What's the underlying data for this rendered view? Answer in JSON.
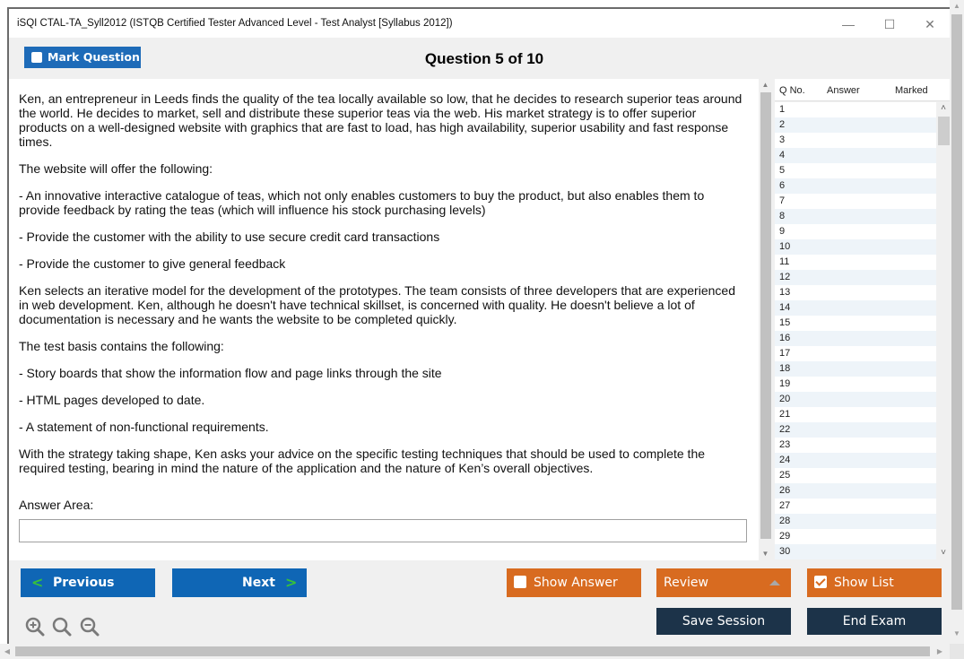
{
  "window": {
    "title": "iSQI CTAL-TA_Syll2012 (ISTQB Certified Tester Advanced Level - Test Analyst [Syllabus 2012])",
    "controls": {
      "minimize": "—",
      "maximize": "☐",
      "close": "✕"
    }
  },
  "header": {
    "mark_question_label": "Mark Question",
    "mark_question_checked": false,
    "question_counter": "Question 5 of 10"
  },
  "question": {
    "paragraphs": [
      "Ken, an entrepreneur in Leeds finds the quality of the tea locally available so low, that he decides to research superior teas around the world. He decides to market, sell and distribute these superior teas via the web. His market strategy is to offer superior products on a well-designed website with graphics that are fast to load, has high availability, superior usability and fast response times.",
      "The website will offer the following:",
      "- An innovative interactive catalogue of teas, which not only enables customers to buy the product, but also enables them to provide feedback by rating the teas (which will influence his stock purchasing levels)",
      "- Provide the customer with the ability to use secure credit card transactions",
      "- Provide the customer to give general feedback",
      "Ken selects an iterative model for the development of the prototypes. The team consists of three developers that are experienced in web development. Ken, although he doesn't have technical skillset, is concerned with quality. He doesn't believe a lot of documentation is necessary and he wants the website to be completed quickly.",
      "The test basis contains the following:",
      "- Story boards that show the information flow and page links through the site",
      "- HTML pages developed to date.",
      "- A statement of non-functional requirements.",
      "With the strategy taking shape, Ken asks your advice on the specific testing techniques that should be used to complete the required testing, bearing in mind the nature of the application and the nature of Ken’s overall objectives."
    ],
    "answer_area_label": "Answer Area:",
    "answer_value": ""
  },
  "question_list": {
    "columns": [
      "Q No.",
      "Answer",
      "Marked"
    ],
    "rows": [
      "1",
      "2",
      "3",
      "4",
      "5",
      "6",
      "7",
      "8",
      "9",
      "10",
      "11",
      "12",
      "13",
      "14",
      "15",
      "16",
      "17",
      "18",
      "19",
      "20",
      "21",
      "22",
      "23",
      "24",
      "25",
      "26",
      "27",
      "28",
      "29",
      "30"
    ]
  },
  "footer": {
    "previous_label": "Previous",
    "next_label": "Next",
    "show_answer_label": "Show Answer",
    "show_answer_checked": false,
    "review_label": "Review",
    "show_list_label": "Show List",
    "show_list_checked": true,
    "save_session_label": "Save Session",
    "end_exam_label": "End Exam",
    "zoom_icons": [
      "zoom-in-icon",
      "zoom-reset-icon",
      "zoom-out-icon"
    ]
  },
  "colors": {
    "primary_blue": "#0f66b5",
    "accent_orange": "#d86b20",
    "navy": "#1c3349",
    "chevron_green": "#38c338"
  }
}
